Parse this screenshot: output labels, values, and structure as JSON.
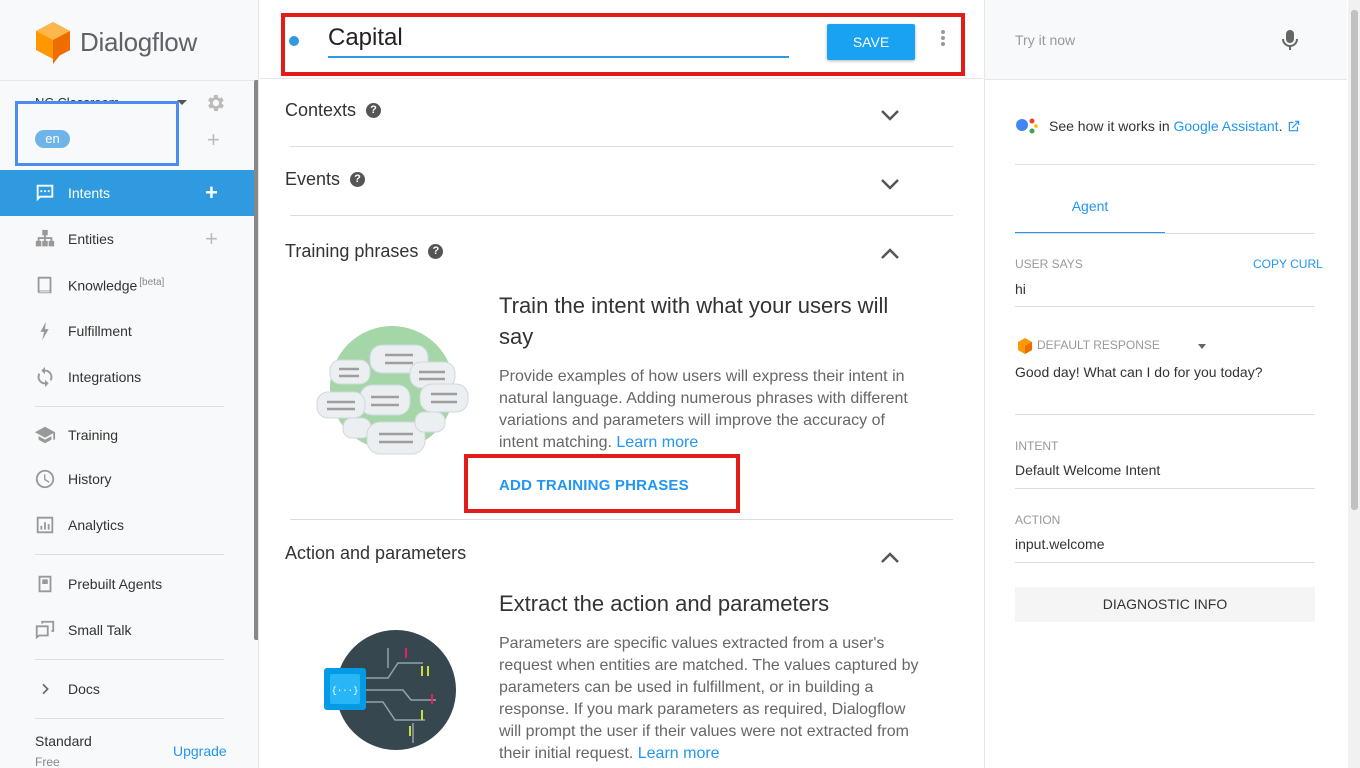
{
  "app": {
    "name": "Dialogflow"
  },
  "sidebar": {
    "agent_name": "NC Classroom",
    "language": "en",
    "items": [
      {
        "label": "Intents",
        "icon": "chat-icon"
      },
      {
        "label": "Entities",
        "icon": "hierarchy-icon"
      },
      {
        "label": "Knowledge",
        "beta": "[beta]",
        "icon": "book-icon"
      },
      {
        "label": "Fulfillment",
        "icon": "bolt-icon"
      },
      {
        "label": "Integrations",
        "icon": "sync-icon"
      },
      {
        "label": "Training",
        "icon": "graduation-cap-icon"
      },
      {
        "label": "History",
        "icon": "clock-icon"
      },
      {
        "label": "Analytics",
        "icon": "bar-chart-icon"
      },
      {
        "label": "Prebuilt Agents",
        "icon": "template-icon"
      },
      {
        "label": "Small Talk",
        "icon": "speech-bubble-icon"
      },
      {
        "label": "Docs",
        "icon": "chevron-right-icon"
      }
    ],
    "plan": "Standard",
    "plan_sub": "Free",
    "upgrade": "Upgrade"
  },
  "editor": {
    "intent_name": "Capital",
    "save_label": "SAVE",
    "sections": {
      "contexts": "Contexts",
      "events": "Events",
      "training": "Training phrases",
      "action": "Action and parameters"
    },
    "training": {
      "title": "Train the intent with what your users will say",
      "body": "Provide examples of how users will express their intent in natural language. Adding numerous phrases with different variations and parameters will improve the accuracy of intent matching.",
      "learn_more": "Learn more",
      "add_button": "ADD TRAINING PHRASES"
    },
    "action": {
      "title": "Extract the action and parameters",
      "body": "Parameters are specific values extracted from a user's request when entities are matched. The values captured by parameters can be used in fulfillment, or in building a response. If you mark parameters as required, Dialogflow will prompt the user if their values were not extracted from their initial request.",
      "learn_more": "Learn more"
    }
  },
  "console": {
    "try_placeholder": "Try it now",
    "ga_text": "See how it works in",
    "ga_link": "Google Assistant",
    "ga_dot": ".",
    "tab": "Agent",
    "user_says_label": "USER SAYS",
    "copy_curl": "COPY CURL",
    "user_says": "hi",
    "default_response_label": "DEFAULT RESPONSE",
    "default_response": "Good day! What can I do for you today?",
    "intent_label": "INTENT",
    "intent": "Default Welcome Intent",
    "action_label": "ACTION",
    "action": "input.welcome",
    "diagnostic": "DIAGNOSTIC INFO"
  },
  "colors": {
    "accent": "#2f9ae0",
    "save": "#19a2f2",
    "highlight_red": "#e31b1b",
    "highlight_blue": "#4a8cf0",
    "logo_orange": "#ff9800"
  }
}
